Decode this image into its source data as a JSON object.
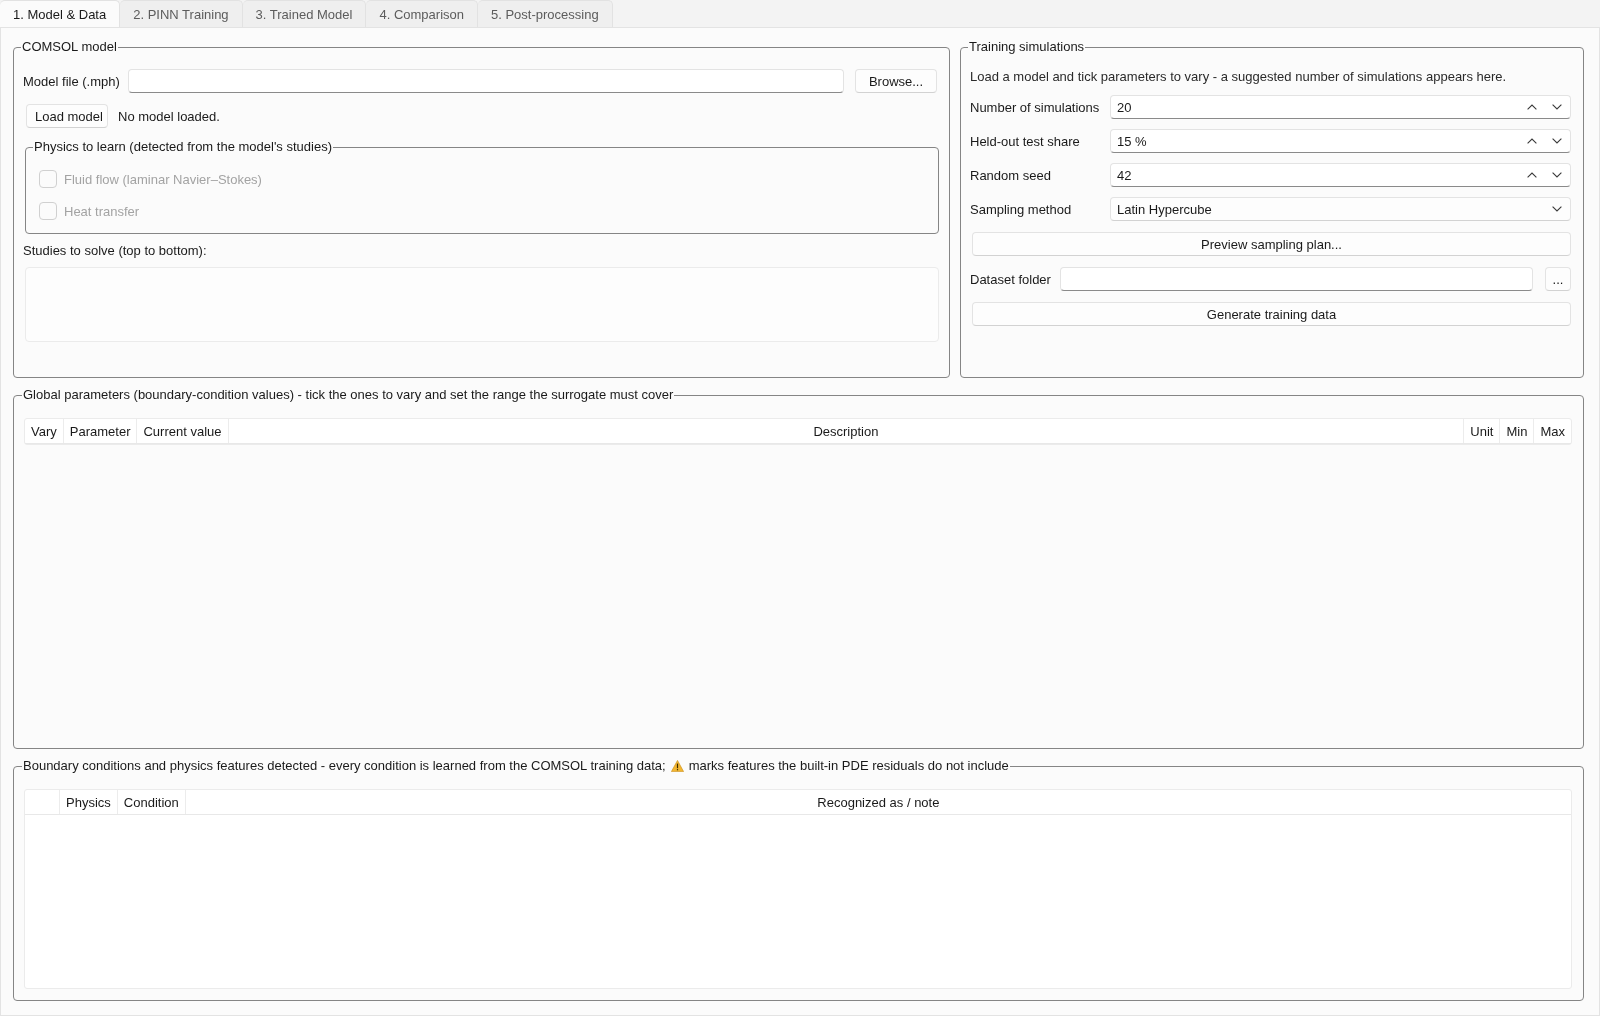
{
  "tabs": [
    {
      "label": "1. Model & Data",
      "selected": true
    },
    {
      "label": "2. PINN Training",
      "selected": false
    },
    {
      "label": "3. Trained Model",
      "selected": false
    },
    {
      "label": "4. Comparison",
      "selected": false
    },
    {
      "label": "5. Post-processing",
      "selected": false
    }
  ],
  "comsol_model": {
    "title": "COMSOL model",
    "model_file": {
      "label": "Model file (.mph)",
      "button": "Browse..."
    },
    "load_button": "Load model",
    "status": "No model loaded.",
    "physics": {
      "title": "Physics to learn (detected from the model's studies)",
      "options": [
        {
          "label": "Fluid flow (laminar Navier–Stokes)",
          "checked": false,
          "disabled": true
        },
        {
          "label": "Heat transfer",
          "checked": false,
          "disabled": true
        }
      ]
    },
    "studies": {
      "label": "Studies to solve (top to bottom):"
    }
  },
  "training_simulations": {
    "title": "Training simulations",
    "hint": "Load a model and tick parameters to vary - a suggested number of simulations appears here.",
    "fields": [
      {
        "kind": "spin",
        "label": "Number of simulations",
        "value": "20"
      },
      {
        "kind": "spin",
        "label": "Held-out test share",
        "value": "15 %"
      },
      {
        "kind": "spin",
        "label": "Random seed",
        "value": "42"
      },
      {
        "kind": "combo",
        "label": "Sampling method",
        "value": "Latin Hypercube"
      }
    ],
    "preview_button": "Preview sampling plan...",
    "dataset_folder": {
      "label": "Dataset folder",
      "button": "..."
    },
    "generate_button": "Generate training data"
  },
  "global_parameters": {
    "title": "Global parameters (boundary-condition values) - tick the ones to vary and set the range the surrogate must cover",
    "columns": [
      {
        "kind": "text",
        "label": "Vary"
      },
      {
        "kind": "text",
        "label": "Parameter"
      },
      {
        "kind": "text",
        "label": "Current value"
      },
      {
        "kind": "text",
        "label": "Description",
        "stretch": true
      },
      {
        "kind": "text",
        "label": "Unit"
      },
      {
        "kind": "text",
        "label": "Min"
      },
      {
        "kind": "text",
        "label": "Max"
      }
    ]
  },
  "boundary_conditions": {
    "title": "Boundary conditions and physics features detected - every condition is learned from the COMSOL training data;",
    "title_after_icon": "marks features the built-in PDE residuals do not include",
    "columns": [
      {
        "kind": "marker"
      },
      {
        "kind": "text",
        "label": "Physics"
      },
      {
        "kind": "text",
        "label": "Condition"
      },
      {
        "kind": "text",
        "label": "Recognized as / note",
        "stretch": true
      }
    ]
  }
}
